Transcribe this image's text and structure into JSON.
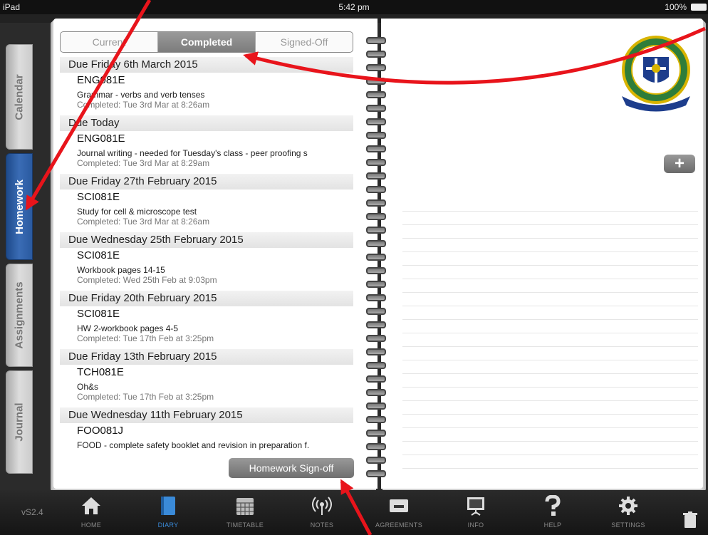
{
  "status": {
    "device": "iPad",
    "time": "5:42 pm",
    "battery": "100%"
  },
  "caption": "",
  "tabs": [
    "Calendar",
    "Homework",
    "Assignments",
    "Journal"
  ],
  "segments": [
    "Current",
    "Completed",
    "Signed-Off"
  ],
  "entries": [
    {
      "due": "Due Friday 6th March 2015",
      "code": "ENG081E",
      "desc": "Grammar - verbs and verb tenses",
      "completed": "Completed: Tue 3rd Mar at 8:26am"
    },
    {
      "due": "Due Today",
      "code": "ENG081E",
      "desc": "Journal writing - needed for Tuesday's class - peer proofing s",
      "completed": "Completed: Tue 3rd Mar at 8:29am"
    },
    {
      "due": "Due Friday 27th February 2015",
      "code": "SCI081E",
      "desc": "Study for cell & microscope test",
      "completed": "Completed: Tue 3rd Mar at 8:26am"
    },
    {
      "due": "Due Wednesday 25th February 2015",
      "code": "SCI081E",
      "desc": "Workbook pages 14-15",
      "completed": "Completed: Wed 25th Feb at 9:03pm"
    },
    {
      "due": "Due Friday 20th February 2015",
      "code": "SCI081E",
      "desc": "HW 2-workbook pages 4-5",
      "completed": "Completed: Tue 17th Feb at 3:25pm"
    },
    {
      "due": "Due Friday 13th February 2015",
      "code": "TCH081E",
      "desc": "Oh&s",
      "completed": "Completed: Tue 17th Feb at 3:25pm"
    },
    {
      "due": "Due Wednesday 11th February 2015",
      "code": "FOO081J",
      "desc": "FOOD - complete safety booklet and revision in preparation f.",
      "completed": ""
    }
  ],
  "signoff_label": "Homework Sign-off",
  "plus_label": "+",
  "version": "vS2.4",
  "tabbar": [
    "HOME",
    "DIARY",
    "TIMETABLE",
    "NOTES",
    "AGREEMENTS",
    "INFO",
    "HELP",
    "SETTINGS"
  ],
  "colors": {
    "active_tab": "#2a5aa0",
    "arrow": "#e8141b",
    "tabbar_active": "#3a8ad8"
  }
}
